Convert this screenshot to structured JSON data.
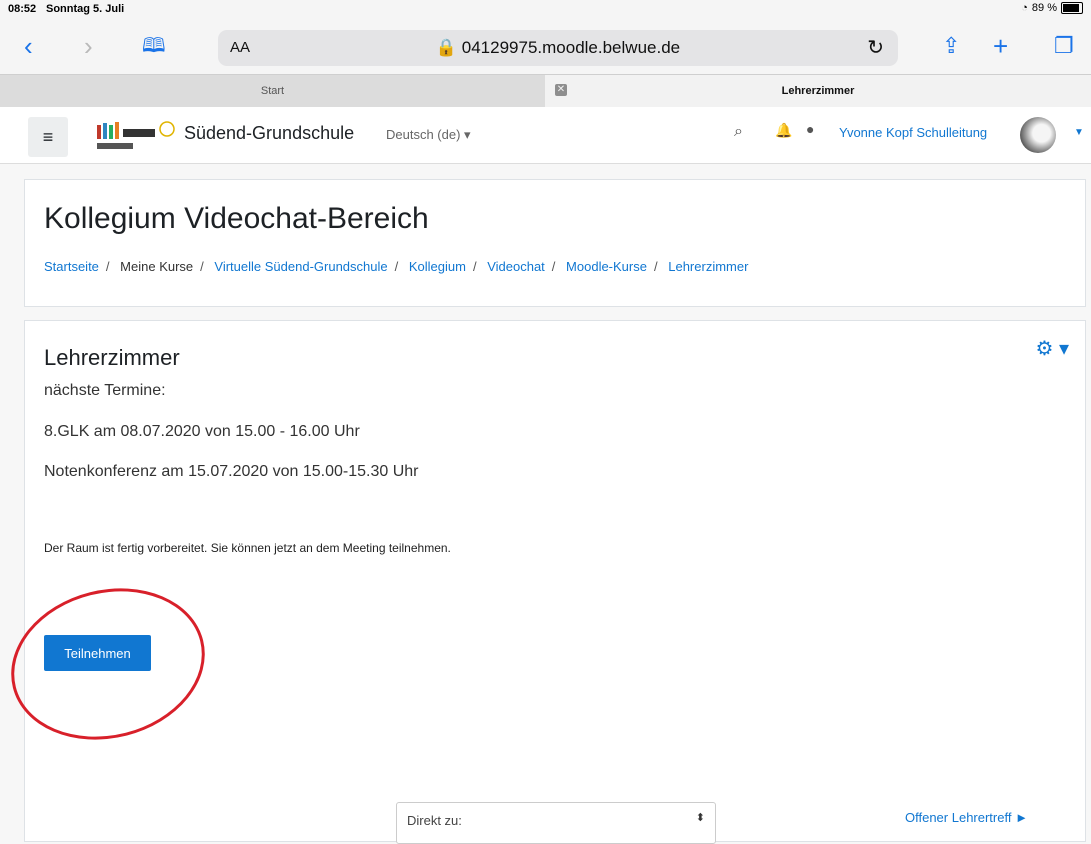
{
  "status_bar": {
    "time": "08:52",
    "date": "Sonntag 5. Juli",
    "battery": "89 %"
  },
  "browser": {
    "text_size": "AA",
    "url": "🔒 04129975.moodle.belwue.de",
    "tabs": [
      {
        "title": "Start"
      },
      {
        "title": "Lehrerzimmer"
      }
    ]
  },
  "moodle_nav": {
    "site_name": "Südend-Grundschule",
    "language": "Deutsch (de) ▾",
    "user": "Yvonne Kopf Schulleitung"
  },
  "page": {
    "title": "Kollegium Videochat-Bereich",
    "breadcrumb": [
      {
        "label": "Startseite",
        "link": true
      },
      {
        "label": "Meine Kurse",
        "link": false
      },
      {
        "label": "Virtuelle Südend-Grundschule",
        "link": true
      },
      {
        "label": "Kollegium",
        "link": true
      },
      {
        "label": "Videochat",
        "link": true
      },
      {
        "label": "Moodle-Kurse",
        "link": true
      },
      {
        "label": "Lehrerzimmer",
        "link": true
      }
    ]
  },
  "activity": {
    "title": "Lehrerzimmer",
    "lines": [
      "nächste Termine:",
      "8.GLK am 08.07.2020 von 15.00 - 16.00 Uhr",
      "Notenkonferenz am 15.07.2020 von 15.00-15.30 Uhr"
    ],
    "info": "Der Raum ist fertig vorbereitet. Sie können jetzt an dem Meeting teilnehmen.",
    "join_label": "Teilnehmen",
    "jump_label": "Direkt zu:",
    "next_link": "Offener Lehrertreff ►"
  },
  "icons": {
    "back": "chevron-left-icon",
    "forward": "chevron-right-icon",
    "bookmarks": "book-icon",
    "share": "share-icon",
    "new_tab": "plus-icon",
    "tabs": "tabs-icon",
    "settings": "gear-icon"
  },
  "colors": {
    "link": "#1177d1",
    "accent_circle": "#d8202a",
    "tab_bar": "#dcdcdc"
  }
}
